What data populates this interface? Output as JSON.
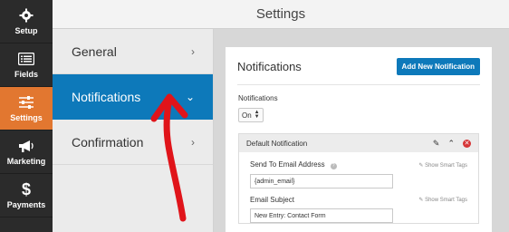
{
  "sidebar": {
    "items": [
      {
        "label": "Setup",
        "icon": "gear-icon"
      },
      {
        "label": "Fields",
        "icon": "list-icon"
      },
      {
        "label": "Settings",
        "icon": "sliders-icon"
      },
      {
        "label": "Marketing",
        "icon": "megaphone-icon"
      },
      {
        "label": "Payments",
        "icon": "dollar-icon"
      }
    ],
    "active_color": "#e27730"
  },
  "header": {
    "title": "Settings"
  },
  "panel_nav": {
    "items": [
      {
        "label": "General",
        "chevron": "›"
      },
      {
        "label": "Notifications",
        "chevron": "⌄"
      },
      {
        "label": "Confirmation",
        "chevron": "›"
      }
    ],
    "active_color": "#0d79ba"
  },
  "main": {
    "title": "Notifications",
    "add_button": "Add New Notification",
    "notifications_label": "Notifications",
    "notifications_select": "On",
    "notification": {
      "title": "Default Notification",
      "fields": [
        {
          "label": "Send To Email Address",
          "smart_tags": "Show Smart Tags",
          "value": "{admin_email}"
        },
        {
          "label": "Email Subject",
          "smart_tags": "Show Smart Tags",
          "value": "New Entry: Contact Form"
        }
      ]
    }
  },
  "annotation_color": "#e0141a"
}
